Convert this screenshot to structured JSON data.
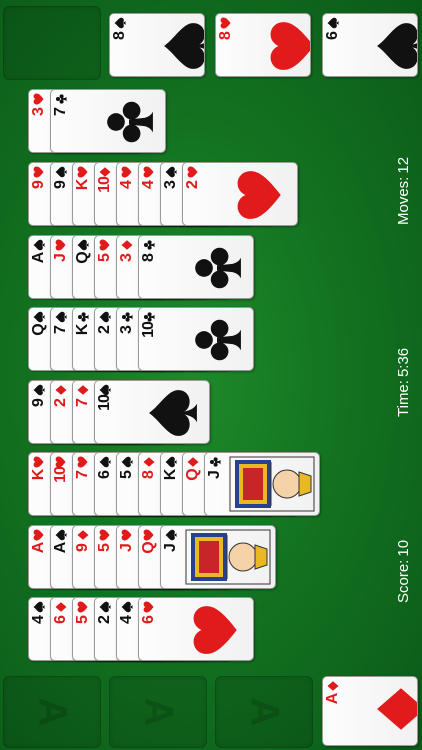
{
  "hud": {
    "moves_label": "Moves:",
    "moves_value": "12",
    "time_label": "Time:",
    "time_value": "5:36",
    "score_label": "Score:",
    "score_value": "10"
  },
  "stock_slot": {},
  "foundation_empty": [
    {
      "label": "A"
    },
    {
      "label": "A"
    },
    {
      "label": "A"
    }
  ],
  "top_piles": [
    {
      "rank": "8",
      "suit": "spade",
      "color": "black"
    },
    {
      "rank": "8",
      "suit": "heart",
      "color": "red"
    },
    {
      "rank": "6",
      "suit": "spade",
      "color": "black"
    }
  ],
  "foundation_filled": {
    "rank": "A",
    "suit": "diamond",
    "color": "red"
  },
  "tableau": [
    [
      {
        "rank": "3",
        "suit": "heart"
      },
      {
        "rank": "7",
        "suit": "club"
      }
    ],
    [
      {
        "rank": "9",
        "suit": "heart"
      },
      {
        "rank": "9",
        "suit": "spade"
      },
      {
        "rank": "K",
        "suit": "heart"
      },
      {
        "rank": "10",
        "suit": "diamond"
      },
      {
        "rank": "4",
        "suit": "heart"
      },
      {
        "rank": "4",
        "suit": "heart"
      },
      {
        "rank": "3",
        "suit": "spade"
      },
      {
        "rank": "2",
        "suit": "heart"
      }
    ],
    [
      {
        "rank": "A",
        "suit": "spade"
      },
      {
        "rank": "J",
        "suit": "heart"
      },
      {
        "rank": "Q",
        "suit": "spade"
      },
      {
        "rank": "5",
        "suit": "heart"
      },
      {
        "rank": "3",
        "suit": "diamond"
      },
      {
        "rank": "8",
        "suit": "club"
      }
    ],
    [
      {
        "rank": "Q",
        "suit": "spade"
      },
      {
        "rank": "7",
        "suit": "spade"
      },
      {
        "rank": "K",
        "suit": "club"
      },
      {
        "rank": "2",
        "suit": "spade"
      },
      {
        "rank": "3",
        "suit": "club"
      },
      {
        "rank": "10",
        "suit": "club"
      }
    ],
    [
      {
        "rank": "9",
        "suit": "spade"
      },
      {
        "rank": "2",
        "suit": "diamond"
      },
      {
        "rank": "7",
        "suit": "diamond"
      },
      {
        "rank": "10",
        "suit": "spade"
      }
    ],
    [
      {
        "rank": "K",
        "suit": "heart"
      },
      {
        "rank": "10",
        "suit": "heart"
      },
      {
        "rank": "7",
        "suit": "heart"
      },
      {
        "rank": "6",
        "suit": "spade"
      },
      {
        "rank": "5",
        "suit": "spade"
      },
      {
        "rank": "8",
        "suit": "diamond"
      },
      {
        "rank": "K",
        "suit": "spade"
      },
      {
        "rank": "Q",
        "suit": "diamond"
      },
      {
        "rank": "J",
        "suit": "club"
      }
    ],
    [
      {
        "rank": "A",
        "suit": "heart"
      },
      {
        "rank": "A",
        "suit": "spade"
      },
      {
        "rank": "9",
        "suit": "diamond"
      },
      {
        "rank": "5",
        "suit": "heart"
      },
      {
        "rank": "J",
        "suit": "heart"
      },
      {
        "rank": "Q",
        "suit": "heart"
      },
      {
        "rank": "J",
        "suit": "spade"
      }
    ],
    [
      {
        "rank": "4",
        "suit": "spade"
      },
      {
        "rank": "6",
        "suit": "diamond"
      },
      {
        "rank": "5",
        "suit": "heart"
      },
      {
        "rank": "2",
        "suit": "spade"
      },
      {
        "rank": "4",
        "suit": "spade"
      },
      {
        "rank": "6",
        "suit": "heart"
      }
    ]
  ]
}
